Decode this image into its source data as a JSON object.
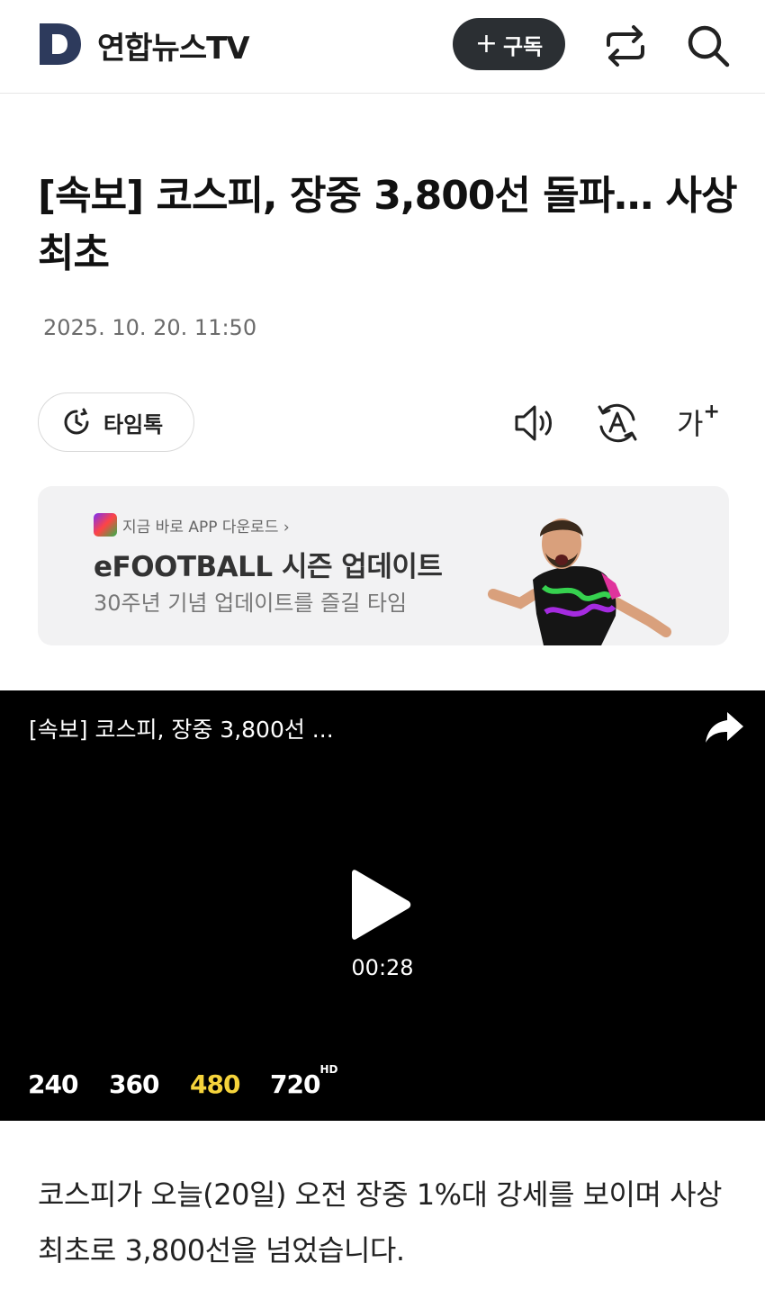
{
  "header": {
    "brand": "연합뉴스TV",
    "subscribe_label": "구독"
  },
  "article": {
    "title": "[속보] 코스피, 장중 3,800선 돌파… 사상 최초",
    "date": "2025. 10. 20. 11:50",
    "body": "코스피가 오늘(20일) 오전 장중 1%대 강세를 보이며 사상 최초로 3,800선을 넘었습니다."
  },
  "toolbar": {
    "timetalk_label": "타임톡",
    "font_size_label": "가",
    "font_size_plus": "+"
  },
  "ad": {
    "tag": "지금 바로 APP 다운로드 ›",
    "title": "eFOOTBALL 시즌 업데이트",
    "subtitle": "30주년 기념 업데이트를 즐길 타임"
  },
  "video": {
    "title": "[속보] 코스피, 장중 3,800선 ...",
    "duration": "00:28",
    "qualities": [
      {
        "label": "240",
        "active": false
      },
      {
        "label": "360",
        "active": false
      },
      {
        "label": "480",
        "active": true
      },
      {
        "label": "720",
        "suffix": "HD",
        "active": false
      }
    ]
  },
  "colors": {
    "accent_quality": "#f5d33b",
    "subscribe_bg": "#2b2f33",
    "logo": "#2d3a5c"
  },
  "icons": [
    "brand-logo-icon",
    "share-icon",
    "search-icon",
    "clock-icon",
    "speaker-icon",
    "translate-icon",
    "play-icon"
  ]
}
